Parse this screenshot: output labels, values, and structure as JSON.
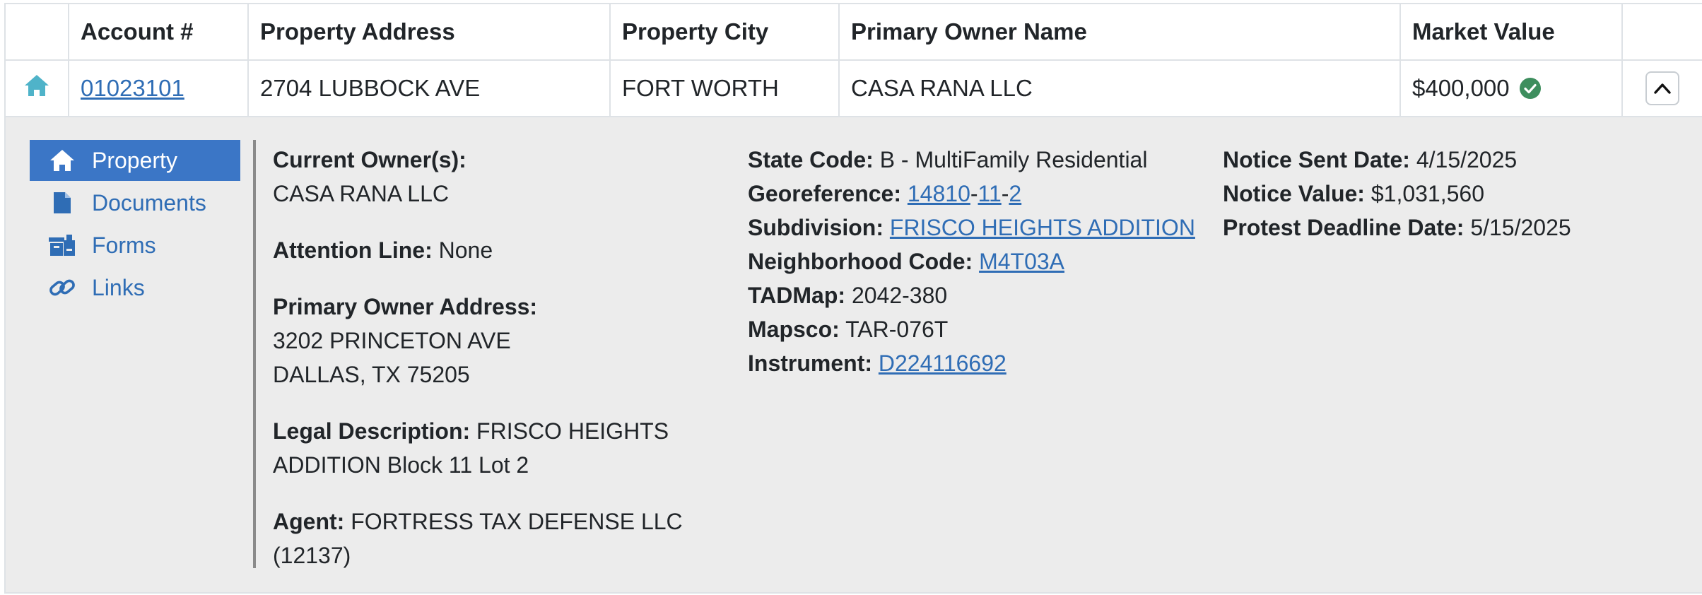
{
  "table": {
    "headers": [
      "",
      "Account #",
      "Property Address",
      "Property City",
      "Primary Owner Name",
      "Market Value",
      ""
    ],
    "row": {
      "account": "01023101",
      "address": "2704 LUBBOCK AVE",
      "city": "FORT WORTH",
      "owner": "CASA RANA LLC",
      "market_value": "$400,000",
      "icon_row": "home-icon",
      "icon_value": "check-circle-icon"
    }
  },
  "nav": {
    "items": [
      {
        "label": "Property",
        "icon": "home-icon",
        "active": true
      },
      {
        "label": "Documents",
        "icon": "document-icon",
        "active": false
      },
      {
        "label": "Forms",
        "icon": "forms-icon",
        "active": false
      },
      {
        "label": "Links",
        "icon": "link-icon",
        "active": false
      }
    ]
  },
  "details": {
    "current_owners_label": "Current Owner(s):",
    "current_owners": "CASA RANA LLC",
    "attention_label": "Attention Line:",
    "attention": "None",
    "primary_address_label": "Primary Owner Address:",
    "primary_address_line1": "3202 PRINCETON AVE",
    "primary_address_line2": "DALLAS, TX 75205",
    "legal_label": "Legal Description:",
    "legal_line1": "FRISCO HEIGHTS",
    "legal_line2": "ADDITION Block 11 Lot 2",
    "agent_label": "Agent:",
    "agent_line1": "FORTRESS TAX DEFENSE LLC",
    "agent_line2": "(12137)",
    "state_code_label": "State Code:",
    "state_code": "B - MultiFamily Residential",
    "georef_label": "Georeference:",
    "georef_parts": [
      "14810",
      "11",
      "2"
    ],
    "georef_sep": "-",
    "subdivision_label": "Subdivision:",
    "subdivision": "FRISCO HEIGHTS ADDITION",
    "neighborhood_label": "Neighborhood Code:",
    "neighborhood": "M4T03A",
    "tadmap_label": "TADMap:",
    "tadmap": "2042-380",
    "mapsco_label": "Mapsco:",
    "mapsco": "TAR-076T",
    "instrument_label": "Instrument:",
    "instrument": "D224116692",
    "notice_sent_label": "Notice Sent Date:",
    "notice_sent": "4/15/2025",
    "notice_value_label": "Notice Value:",
    "notice_value": "$1,031,560",
    "protest_label": "Protest Deadline Date:",
    "protest": "5/15/2025"
  },
  "colors": {
    "link": "#2f6db5",
    "nav_active_bg": "#3b76c6",
    "home_teal": "#4fb3c9",
    "check_green": "#3e8e5e",
    "detail_bg": "#ececec"
  }
}
